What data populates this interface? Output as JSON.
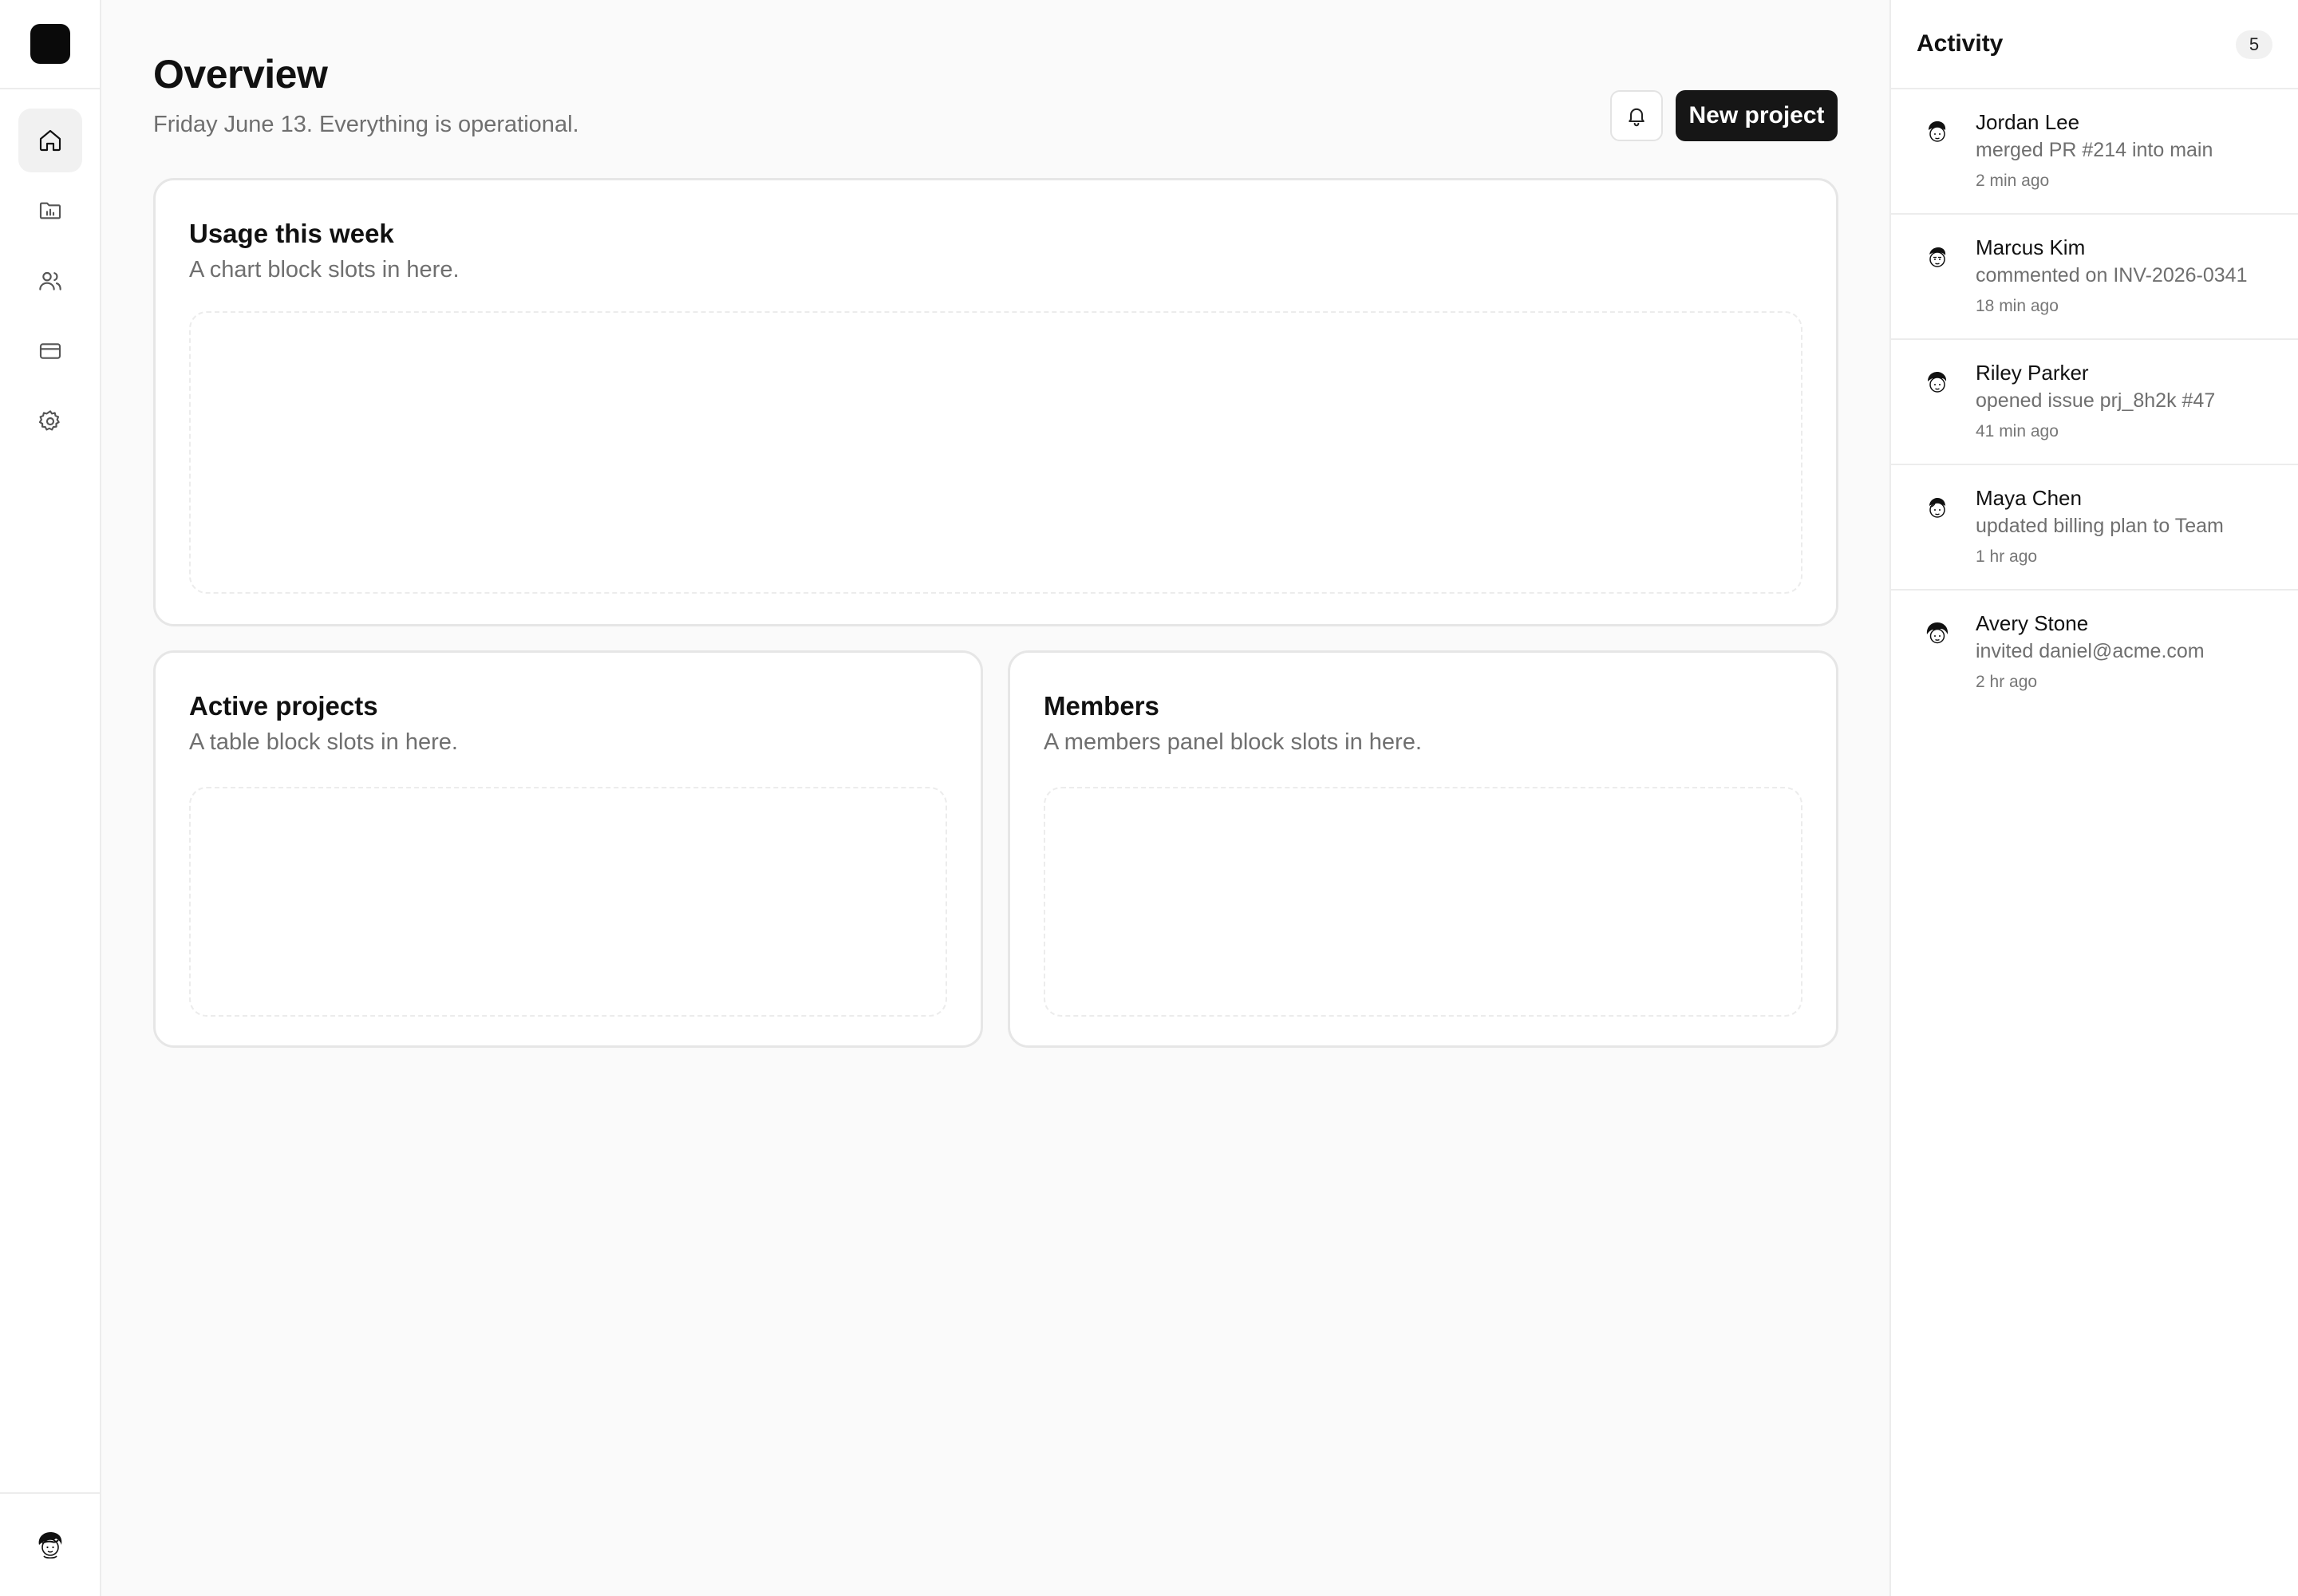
{
  "page": {
    "title": "Overview",
    "subtitle": "Friday June 13. Everything is operational."
  },
  "nav": {
    "items": [
      {
        "icon": "home-icon",
        "active": true
      },
      {
        "icon": "folder-icon",
        "active": false
      },
      {
        "icon": "users-icon",
        "active": false
      },
      {
        "icon": "credit-card-icon",
        "active": false
      },
      {
        "icon": "gear-icon",
        "active": false
      }
    ]
  },
  "header": {
    "new_project_label": "New project"
  },
  "cards": {
    "usage": {
      "title": "Usage this week",
      "desc": "A chart block slots in here."
    },
    "projects": {
      "title": "Active projects",
      "desc": "A table block slots in here."
    },
    "members": {
      "title": "Members",
      "desc": "A members panel block slots in here."
    }
  },
  "activity": {
    "title": "Activity",
    "count": "5",
    "items": [
      {
        "name": "Jordan Lee",
        "message": "merged PR #214 into main",
        "time": "2 min ago"
      },
      {
        "name": "Marcus Kim",
        "message": "commented on INV-2026-0341",
        "time": "18 min ago"
      },
      {
        "name": "Riley Parker",
        "message": "opened issue prj_8h2k #47",
        "time": "41 min ago"
      },
      {
        "name": "Maya Chen",
        "message": "updated billing plan to Team",
        "time": "1 hr ago"
      },
      {
        "name": "Avery Stone",
        "message": "invited daniel@acme.com",
        "time": "2 hr ago"
      }
    ]
  },
  "colors": {
    "accent": "#161616",
    "background": "#fafafa",
    "border": "#e6e6e6",
    "muted_text": "#6f6f6f"
  }
}
